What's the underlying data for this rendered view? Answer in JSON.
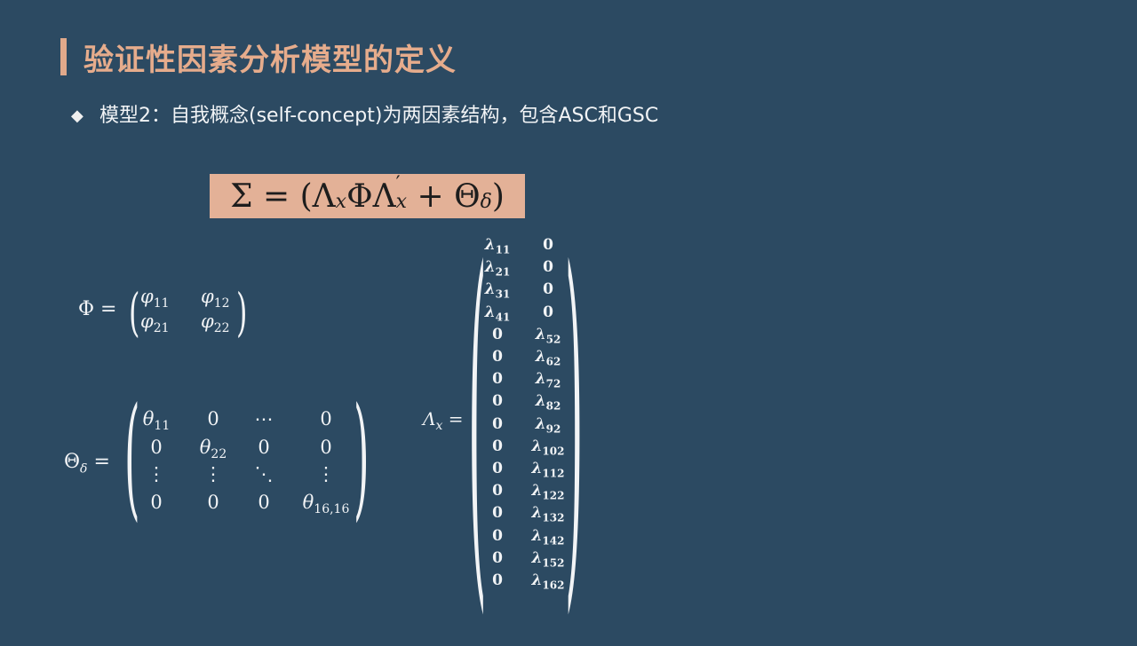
{
  "title": "验证性因素分析模型的定义",
  "bullet": {
    "icon": "diamond-bullet-icon",
    "text": "模型2：自我概念(self-concept)为两因素结构，包含ASC和GSC"
  },
  "colors": {
    "background": "#2c4a62",
    "accent": "#e0a98b",
    "formula_box": "#e3b197"
  },
  "formula": {
    "sigma": "Σ",
    "equals": " = (",
    "lambda": "Λ",
    "x": "x",
    "phi": "Φ",
    "prime": "′",
    "plus": " + ",
    "theta": "Θ",
    "delta": "δ",
    "close": ")"
  },
  "phi_matrix": {
    "lhs": "Φ =",
    "rows": [
      [
        "φ",
        "11",
        "φ",
        "12"
      ],
      [
        "φ",
        "21",
        "φ",
        "22"
      ]
    ]
  },
  "theta_matrix": {
    "lhs_symbol": "Θ",
    "lhs_sub": "δ",
    "equals": "=",
    "rows": [
      [
        "θ11",
        "0",
        "⋯",
        "0"
      ],
      [
        "0",
        "θ22",
        "0",
        "0"
      ],
      [
        "⋮",
        "⋮",
        "⋱",
        "⋮"
      ],
      [
        "0",
        "0",
        "0",
        "θ16,16"
      ]
    ]
  },
  "lambda_matrix": {
    "lhs_symbol": "Λ",
    "lhs_sub": "x",
    "equals": "=",
    "rows": [
      [
        "λ",
        "11",
        "0",
        ""
      ],
      [
        "λ",
        "21",
        "0",
        ""
      ],
      [
        "λ",
        "31",
        "0",
        ""
      ],
      [
        "λ",
        "41",
        "0",
        ""
      ],
      [
        "0",
        "",
        "λ",
        "52"
      ],
      [
        "0",
        "",
        "λ",
        "62"
      ],
      [
        "0",
        "",
        "λ",
        "72"
      ],
      [
        "0",
        "",
        "λ",
        "82"
      ],
      [
        "0",
        "",
        "λ",
        "92"
      ],
      [
        "0",
        "",
        "λ",
        "102"
      ],
      [
        "0",
        "",
        "λ",
        "112"
      ],
      [
        "0",
        "",
        "λ",
        "122"
      ],
      [
        "0",
        "",
        "λ",
        "132"
      ],
      [
        "0",
        "",
        "λ",
        "142"
      ],
      [
        "0",
        "",
        "λ",
        "152"
      ],
      [
        "0",
        "",
        "λ",
        "162"
      ]
    ]
  }
}
